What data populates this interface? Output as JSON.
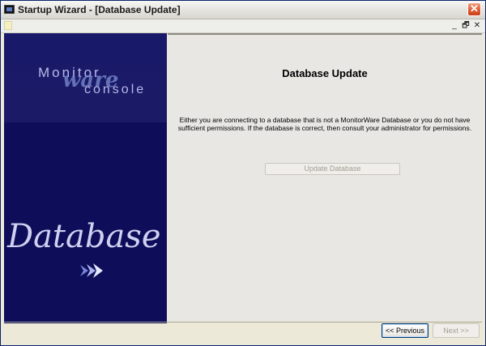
{
  "window": {
    "title": "Startup Wizard  - [Database Update]",
    "close_symbol": "✕"
  },
  "menubar": {
    "minimize_symbol": "_",
    "restore_symbol": "🗗",
    "close_symbol": "✕"
  },
  "sidebar": {
    "logo_word_top": "Monitor",
    "logo_word_script": "ware",
    "logo_word_bottom": "console",
    "banner_text": "Database"
  },
  "main": {
    "title": "Database Update",
    "message_line1": "Either you are connecting to a database that is not a MonitorWare Database or you do not have",
    "message_line2": "sufficient permissions. If the database is correct, then consult your administrator for permissions.",
    "update_button_label": "Update Database"
  },
  "footer": {
    "previous_label": "<< Previous",
    "next_label": "Next >>"
  },
  "colors": {
    "sidebar_bg": "#0d0d5a",
    "titlebar_close": "#e2613b",
    "focus_border": "#003c74"
  }
}
